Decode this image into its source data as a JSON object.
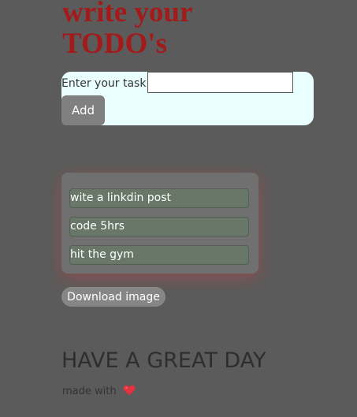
{
  "header": {
    "title_line1": "write your",
    "title_line2": "TODO's"
  },
  "form": {
    "task_label": "Enter your task:",
    "task_value": "",
    "task_placeholder": "",
    "add_label": "Add"
  },
  "todos": [
    {
      "text": "wite a linkdin post"
    },
    {
      "text": "code 5hrs"
    },
    {
      "text": "hit the gym"
    }
  ],
  "download_label": "Download image",
  "footer": {
    "heading": "HAVE A GREAT DAY",
    "made_with": "made with",
    "heart_icon": "heart-icon",
    "heart_color": "#e3333f"
  },
  "colors": {
    "background": "#5b5b5b",
    "title": "#a31a1a",
    "form_bg": "#eaffff",
    "todo_item_bg": "#687768"
  }
}
